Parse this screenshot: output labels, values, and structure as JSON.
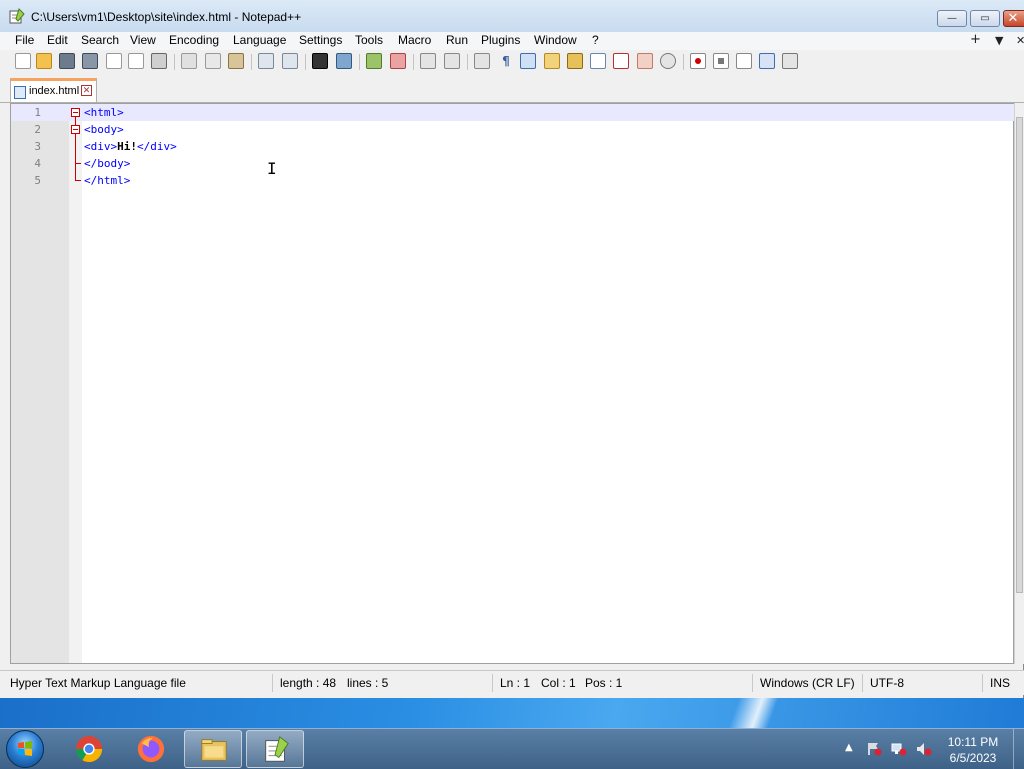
{
  "window": {
    "title": "C:\\Users\\vm1\\Desktop\\site\\index.html - Notepad++",
    "min_glyph": "—",
    "max_glyph": "▭",
    "close_glyph": "✕"
  },
  "menu": {
    "items": [
      "File",
      "Edit",
      "Search",
      "View",
      "Encoding",
      "Language",
      "Settings",
      "Tools",
      "Macro",
      "Run",
      "Plugins",
      "Window",
      "?"
    ],
    "right": [
      "+",
      "▼",
      "✕"
    ]
  },
  "toolbar": {
    "icons": [
      "new-file-icon",
      "open-file-icon",
      "save-icon",
      "save-all-icon",
      "close-icon",
      "close-all-icon",
      "print-icon",
      "cut-icon",
      "copy-icon",
      "paste-icon",
      "undo-icon",
      "redo-icon",
      "find-icon",
      "replace-icon",
      "zoom-in-icon",
      "zoom-out-icon",
      "sync-v-icon",
      "sync-h-icon",
      "word-wrap-icon",
      "show-all-chars-icon",
      "indent-guide-icon",
      "user-lang-icon",
      "doc-map-icon",
      "function-list-icon",
      "folder-workspace-icon",
      "doc-list-icon",
      "monitoring-icon",
      "record-macro-icon",
      "stop-record-icon",
      "play-macro-icon",
      "run-macro-multiple-icon",
      "save-macro-icon"
    ]
  },
  "tab": {
    "label": "index.html",
    "close_glyph": "✕"
  },
  "editor": {
    "lines": [
      {
        "num": "1",
        "code": "<html>"
      },
      {
        "num": "2",
        "code": "<body>"
      },
      {
        "num": "3",
        "pre": "<div>",
        "text": "Hi!",
        "post": "</div>"
      },
      {
        "num": "4",
        "code": "</body>"
      },
      {
        "num": "5",
        "code": "</html>"
      }
    ],
    "cursor_glyph": "I"
  },
  "status": {
    "file_type": "Hyper Text Markup Language file",
    "length": "length : 48",
    "lines": "lines : 5",
    "ln": "Ln : 1",
    "col": "Col : 1",
    "pos": "Pos : 1",
    "eol": "Windows (CR LF)",
    "encoding": "UTF-8",
    "mode": "INS"
  },
  "taskbar": {
    "apps": [
      "chrome-icon",
      "firefox-icon",
      "file-explorer-icon",
      "notepad-plus-plus-icon"
    ],
    "tray_arrow": "▲",
    "time": "10:11 PM",
    "date": "6/5/2023"
  },
  "colors": {
    "tag": "#0000ff",
    "current_line": "#e8e8ff",
    "fold_marker": "#cc0000",
    "tab_accent": "#f4a460"
  }
}
